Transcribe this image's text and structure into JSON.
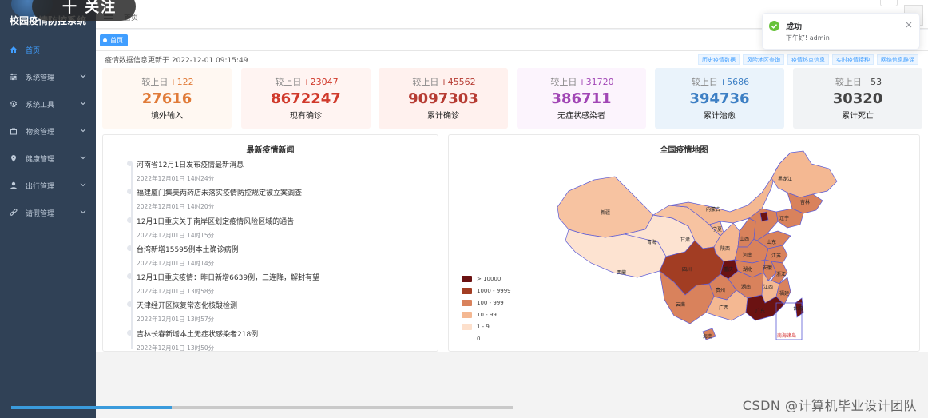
{
  "app": {
    "brand": "校园疫情防控系统",
    "overlay_follow": "十 关注"
  },
  "sidebar": {
    "items": [
      {
        "label": "首页",
        "icon": "home-icon",
        "active": true
      },
      {
        "label": "系统管理",
        "icon": "sliders-icon"
      },
      {
        "label": "系统工具",
        "icon": "gear-icon"
      },
      {
        "label": "物资管理",
        "icon": "bag-icon"
      },
      {
        "label": "健康管理",
        "icon": "location-icon"
      },
      {
        "label": "出行管理",
        "icon": "user-icon"
      },
      {
        "label": "请假管理",
        "icon": "link-icon"
      }
    ]
  },
  "navbar": {
    "breadcrumb": "首页"
  },
  "tags": {
    "home": "首页"
  },
  "main": {
    "update_line": "疫情数据信息更新于 2022-12-01 09:15:49",
    "quick_links": [
      "历史疫情数据",
      "风险地区查询",
      "疫情热点信息",
      "实时疫情接种",
      "网络信息辟谣"
    ]
  },
  "stats": [
    {
      "delta_label": "较上日",
      "delta": "+122",
      "value": "27616",
      "label": "境外输入",
      "color": "#e07b39",
      "bg": "#fff8f2"
    },
    {
      "delta_label": "较上日",
      "delta": "+23047",
      "value": "8672247",
      "label": "现有确诊",
      "color": "#d0392b",
      "bg": "#fff4f2"
    },
    {
      "delta_label": "较上日",
      "delta": "+45562",
      "value": "9097303",
      "label": "累计确诊",
      "color": "#b63b32",
      "bg": "#fff1ee"
    },
    {
      "delta_label": "较上日",
      "delta": "+31720",
      "value": "386711",
      "label": "无症状感染者",
      "color": "#a146b5",
      "bg": "#fcf4fd"
    },
    {
      "delta_label": "较上日",
      "delta": "+5686",
      "value": "394736",
      "label": "累计治愈",
      "color": "#3d7fc4",
      "bg": "#eaf3fb"
    },
    {
      "delta_label": "较上日",
      "delta": "+53",
      "value": "30320",
      "label": "累计死亡",
      "color": "#444444",
      "bg": "#f1f3f5"
    }
  ],
  "news": {
    "title": "最新疫情新闻",
    "items": [
      {
        "title": "河南省12月1日发布疫情最新消息",
        "time": "2022年12月01日 14时24分"
      },
      {
        "title": "福建厦门集美两药店未落实疫情防控规定被立案调查",
        "time": "2022年12月01日 14时20分"
      },
      {
        "title": "12月1日重庆关于南岸区划定疫情风险区域的通告",
        "time": "2022年12月01日 14时15分"
      },
      {
        "title": "台湾新增15595例本土确诊病例",
        "time": "2022年12月01日 14时14分"
      },
      {
        "title": "12月1日重庆疫情：昨日新增6639例，三连降，解封有望",
        "time": "2022年12月01日 13时58分"
      },
      {
        "title": "天津经开区恢复常态化核酸检测",
        "time": "2022年12月01日 13时57分"
      },
      {
        "title": "吉林长春新增本土无症状感染者218例",
        "time": "2022年12月01日 13时50分"
      }
    ]
  },
  "map": {
    "title": "全国疫情地图",
    "legend": [
      {
        "label": "> 10000",
        "color": "#6b1212"
      },
      {
        "label": "1000 - 9999",
        "color": "#a23d23"
      },
      {
        "label": "100 - 999",
        "color": "#d9825c"
      },
      {
        "label": "10 - 99",
        "color": "#f4b892"
      },
      {
        "label": "1 - 9",
        "color": "#fde0cc"
      },
      {
        "label": "0",
        "color": "#ffffff"
      }
    ],
    "provinces": [
      "新疆",
      "西藏",
      "青海",
      "甘肃",
      "内蒙古",
      "黑龙江",
      "吉林",
      "辽宁",
      "宁夏",
      "山西",
      "山东",
      "河南",
      "陕西",
      "四川",
      "重庆",
      "湖北",
      "安徽",
      "江苏",
      "浙江",
      "湖南",
      "江西",
      "贵州",
      "云南",
      "广西",
      "广东",
      "福建",
      "海南",
      "台湾"
    ],
    "inset": "南海诸岛"
  },
  "toast": {
    "title": "成功",
    "message": "下午好! admin"
  },
  "progress": {
    "value": 0.32
  },
  "watermark": "CSDN @计算机毕业设计团队"
}
